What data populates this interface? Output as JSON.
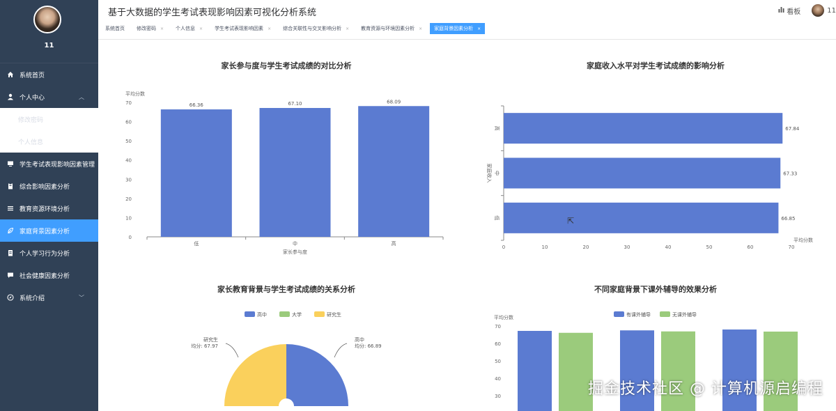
{
  "user": {
    "name": "11"
  },
  "sidebar": {
    "items": [
      {
        "label": "系统首页",
        "icon": "home-icon"
      },
      {
        "label": "个人中心",
        "icon": "user-icon",
        "expanded": true,
        "children": [
          {
            "label": "修改密码"
          },
          {
            "label": "个人信息"
          }
        ]
      },
      {
        "label": "学生考试表现影响因素管理",
        "icon": "monitor-icon"
      },
      {
        "label": "综合影响因素分析",
        "icon": "clipboard-icon"
      },
      {
        "label": "教育资源环境分析",
        "icon": "list-icon"
      },
      {
        "label": "家庭背景因素分析",
        "icon": "leaf-icon",
        "active": true
      },
      {
        "label": "个人学习行为分析",
        "icon": "document-icon"
      },
      {
        "label": "社会健康因素分析",
        "icon": "chat-icon"
      },
      {
        "label": "系统介绍",
        "icon": "compass-icon"
      }
    ]
  },
  "header": {
    "title": "基于大数据的学生考试表现影响因素可视化分析系统",
    "dashboard_label": "看板",
    "user_name": "11"
  },
  "tabs": [
    {
      "label": "系统首页",
      "closable": false
    },
    {
      "label": "修改密码",
      "closable": true
    },
    {
      "label": "个人信息",
      "closable": true
    },
    {
      "label": "学生考试表现影响因素",
      "closable": true
    },
    {
      "label": "综合关联性与交叉影响分析",
      "closable": true
    },
    {
      "label": "教育资源与环境因素分析",
      "closable": true
    },
    {
      "label": "家庭背景因素分析",
      "closable": true,
      "active": true
    }
  ],
  "colors": {
    "sidebar_bg": "#304156",
    "accent": "#409eff",
    "series_blue": "#5b7bd1",
    "series_green": "#9bcb7c",
    "series_yellow": "#fad05c"
  },
  "watermark": "掘金技术社区 @ 计算机源启编程",
  "chart_data": [
    {
      "type": "bar",
      "title": "家长参与度与学生考试成绩的对比分析",
      "categories": [
        "低",
        "中",
        "高"
      ],
      "values": [
        66.36,
        67.1,
        68.09
      ],
      "value_labels": [
        "66.36",
        "67.10",
        "68.09"
      ],
      "xlabel": "家长参与度",
      "ylabel": "平均分数",
      "ylim": [
        0,
        70
      ],
      "yticks": [
        "0",
        "10",
        "20",
        "30",
        "40",
        "50",
        "60",
        "70"
      ]
    },
    {
      "type": "bar",
      "orientation": "horizontal",
      "title": "家庭收入水平对学生考试成绩的影响分析",
      "categories": [
        "高",
        "中",
        "低"
      ],
      "values": [
        67.84,
        67.33,
        66.85
      ],
      "value_labels": [
        "67.84",
        "67.33",
        "66.85"
      ],
      "xlabel": "平均分数",
      "ylabel": "家庭收入",
      "xlim": [
        0,
        70
      ],
      "xticks": [
        "0",
        "10",
        "20",
        "30",
        "40",
        "50",
        "60",
        "70"
      ]
    },
    {
      "type": "pie",
      "title": "家长教育背景与学生考试成绩的关系分析",
      "legend": [
        "高中",
        "大学",
        "研究生"
      ],
      "slices": [
        {
          "name": "高中",
          "value": 66.89,
          "label_name": "高中",
          "label_value": "均分: 66.89"
        },
        {
          "name": "研究生",
          "value": 67.97,
          "label_name": "研究生",
          "label_value": "均分: 67.97"
        }
      ]
    },
    {
      "type": "bar",
      "title": "不同家庭背景下课外辅导的效果分析",
      "legend": [
        "有课外辅导",
        "无课外辅导"
      ],
      "ylabel": "平均分数",
      "yticks": [
        "30",
        "40",
        "50",
        "60",
        "70"
      ],
      "ylim": [
        25,
        70
      ],
      "series": [
        {
          "name": "有课外辅导",
          "values": [
            67.2,
            67.5,
            68.0
          ]
        },
        {
          "name": "无课外辅导",
          "values": [
            66.1,
            66.9,
            66.8
          ]
        }
      ]
    }
  ]
}
